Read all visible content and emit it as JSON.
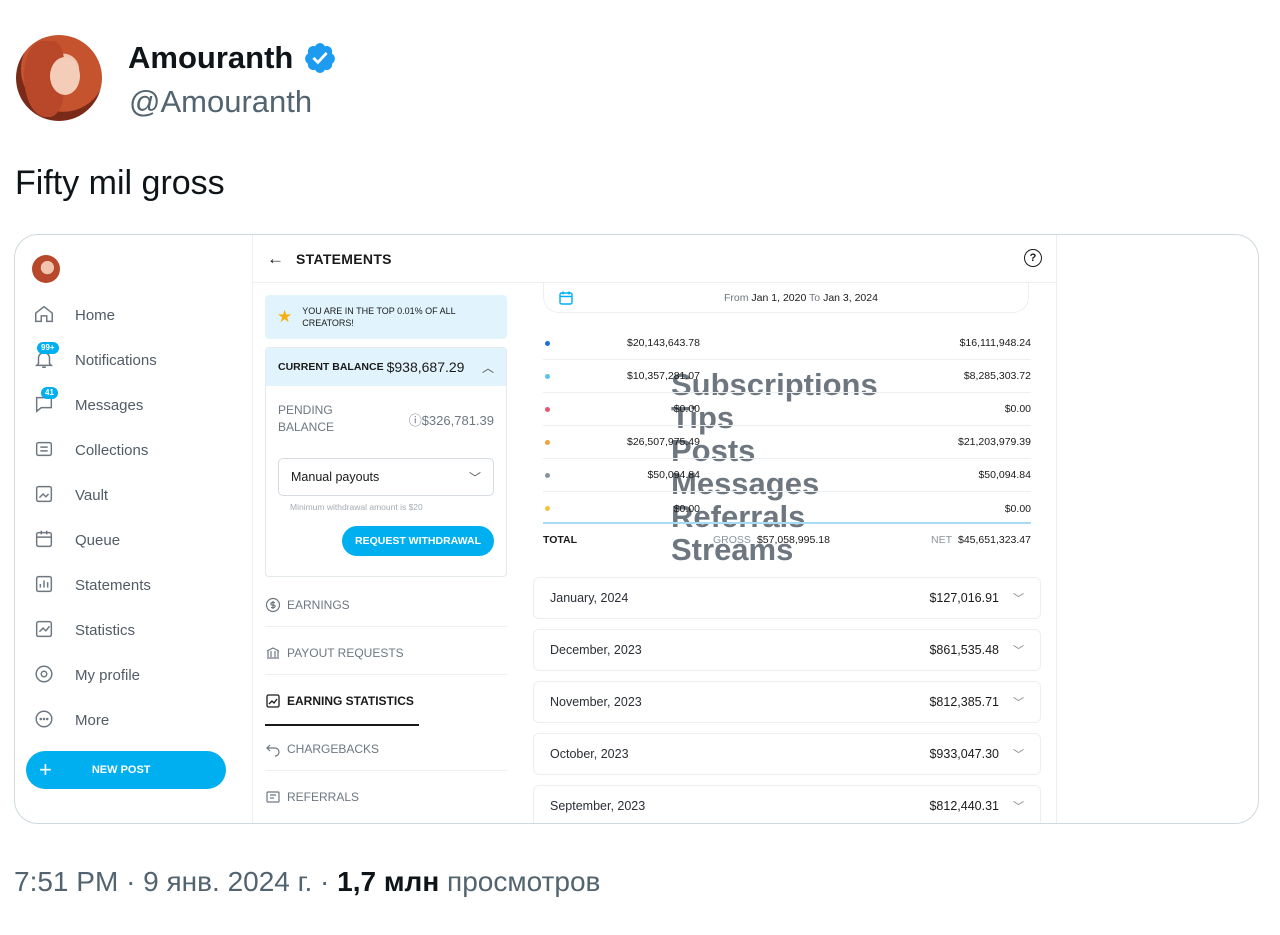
{
  "tweet": {
    "display_name": "Amouranth",
    "handle": "@Amouranth",
    "text": "Fifty mil gross",
    "time": "7:51 PM",
    "sep1": "·",
    "date": "9 янв. 2024 г.",
    "sep2": "·",
    "views_count": "1,7 млн",
    "views_label": "просмотров",
    "colors": {
      "verified": "#1d9bf0"
    }
  },
  "of_sidebar": {
    "items": [
      {
        "label": "Home",
        "icon": "home-icon"
      },
      {
        "label": "Notifications",
        "icon": "bell-icon",
        "badge": "99+"
      },
      {
        "label": "Messages",
        "icon": "message-icon",
        "badge": "41"
      },
      {
        "label": "Collections",
        "icon": "collections-icon"
      },
      {
        "label": "Vault",
        "icon": "vault-icon"
      },
      {
        "label": "Queue",
        "icon": "calendar-icon"
      },
      {
        "label": "Statements",
        "icon": "statements-icon"
      },
      {
        "label": "Statistics",
        "icon": "statistics-icon"
      },
      {
        "label": "My profile",
        "icon": "profile-icon"
      },
      {
        "label": "More",
        "icon": "more-icon"
      }
    ],
    "new_post_label": "NEW POST",
    "new_post_plus": "+",
    "accent": "#00aff0"
  },
  "statements": {
    "title": "STATEMENTS",
    "back_arrow": "←",
    "help_glyph": "?",
    "banner_text": "YOU ARE IN THE TOP 0.01% OF ALL CREATORS!",
    "current_balance_label": "CURRENT BALANCE",
    "current_balance_value": "$938,687.29",
    "pending_label": "PENDING BALANCE",
    "pending_value": "ⓘ$326,781.39",
    "payout_select_value": "Manual payouts",
    "min_withdrawal_note": "Minimum withdrawal amount is $20",
    "request_button": "REQUEST WITHDRAWAL",
    "tabs": [
      {
        "label": "EARNINGS"
      },
      {
        "label": "PAYOUT REQUESTS"
      },
      {
        "label": "EARNING STATISTICS"
      },
      {
        "label": "CHARGEBACKS"
      },
      {
        "label": "REFERRALS"
      }
    ],
    "date_from_label": "From",
    "date_from": "Jan 1, 2020",
    "date_to_label": "To",
    "date_to": "Jan 3, 2024",
    "stats": [
      {
        "name": "Subscriptions",
        "gross": "$20,143,643.78",
        "net": "$16,111,948.24",
        "color": "#1e6fd9"
      },
      {
        "name": "Tips",
        "gross": "$10,357,281.07",
        "net": "$8,285,303.72",
        "color": "#5cc1ec"
      },
      {
        "name": "Posts",
        "gross": "$0.00",
        "net": "$0.00",
        "color": "#e8556b"
      },
      {
        "name": "Messages",
        "gross": "$26,507,975.49",
        "net": "$21,203,979.39",
        "color": "#f3a33b"
      },
      {
        "name": "Referrals",
        "gross": "$50,094.84",
        "net": "$50,094.84",
        "color": "#8a939b"
      },
      {
        "name": "Streams",
        "gross": "$0.00",
        "net": "$0.00",
        "color": "#f3c33b"
      }
    ],
    "total_label": "TOTAL",
    "gross_label": "GROSS",
    "gross_total": "$57,058,995.18",
    "net_label": "NET",
    "net_total": "$45,651,323.47",
    "months": [
      {
        "month": "January, 2024",
        "value": "$127,016.91"
      },
      {
        "month": "December, 2023",
        "value": "$861,535.48"
      },
      {
        "month": "November, 2023",
        "value": "$812,385.71"
      },
      {
        "month": "October, 2023",
        "value": "$933,047.30"
      },
      {
        "month": "September, 2023",
        "value": "$812,440.31"
      }
    ]
  }
}
